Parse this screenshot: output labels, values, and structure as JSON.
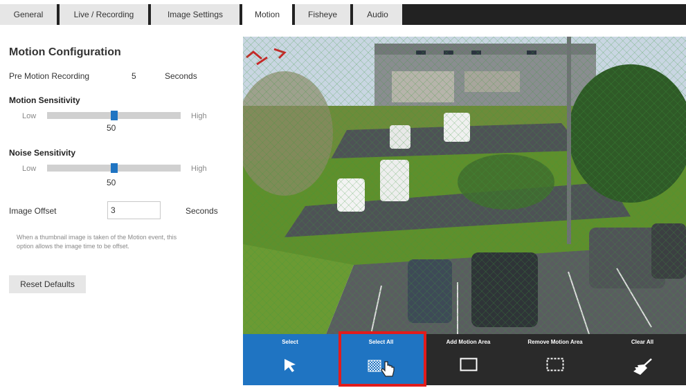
{
  "tabs": [
    {
      "label": "General",
      "active": false
    },
    {
      "label": "Live / Recording",
      "active": false
    },
    {
      "label": "Image Settings",
      "active": false
    },
    {
      "label": "Motion",
      "active": true
    },
    {
      "label": "Fisheye",
      "active": false
    },
    {
      "label": "Audio",
      "active": false
    }
  ],
  "motion_config": {
    "title": "Motion Configuration",
    "pre_motion": {
      "label": "Pre Motion Recording",
      "value": "5",
      "unit": "Seconds"
    },
    "motion_sensitivity": {
      "label": "Motion Sensitivity",
      "low": "Low",
      "high": "High",
      "value": "50",
      "fraction": 0.5
    },
    "noise_sensitivity": {
      "label": "Noise Sensitivity",
      "low": "Low",
      "high": "High",
      "value": "50",
      "fraction": 0.5
    },
    "image_offset": {
      "label": "Image Offset",
      "value": "3",
      "unit": "Seconds"
    },
    "description": "When a thumbnail image is taken of the Motion event, this option allows the image time to be offset.",
    "reset_label": "Reset Defaults"
  },
  "toolbar": {
    "select": "Select",
    "select_all": "Select All",
    "add_area": "Add Motion Area",
    "remove_area": "Remove Motion Area",
    "clear_all": "Clear All"
  },
  "colors": {
    "accent": "#1f74c2",
    "toolbar_bg": "#2a2a2a",
    "highlight": "#e11c1c",
    "motion_grid": "#3a9a3a"
  }
}
